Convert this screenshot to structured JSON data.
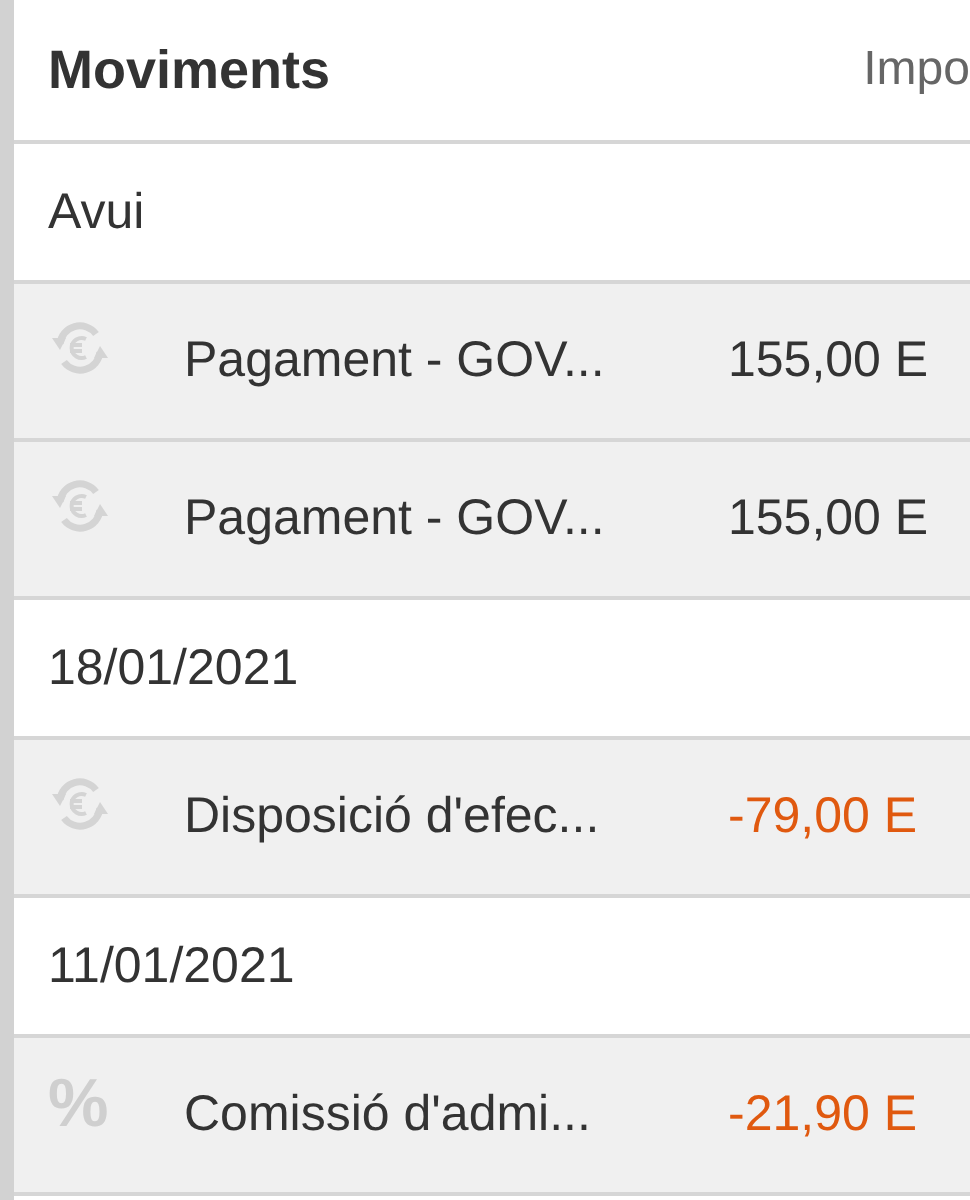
{
  "header": {
    "title": "Moviments",
    "column_label": "Impo"
  },
  "groups": [
    {
      "date": "Avui",
      "items": [
        {
          "kind": "exchange",
          "description": "Pagament - GOV...",
          "amount": "155,00 E",
          "negative": false
        },
        {
          "kind": "exchange",
          "description": "Pagament - GOV...",
          "amount": "155,00 E",
          "negative": false
        }
      ]
    },
    {
      "date": "18/01/2021",
      "items": [
        {
          "kind": "exchange",
          "description": "Disposició d'efec...",
          "amount": "-79,00 E",
          "negative": true
        }
      ]
    },
    {
      "date": "11/01/2021",
      "items": [
        {
          "kind": "percent",
          "symbol": "%",
          "description": "Comissió d'admi...",
          "amount": "-21,90 E",
          "negative": true
        }
      ]
    }
  ]
}
